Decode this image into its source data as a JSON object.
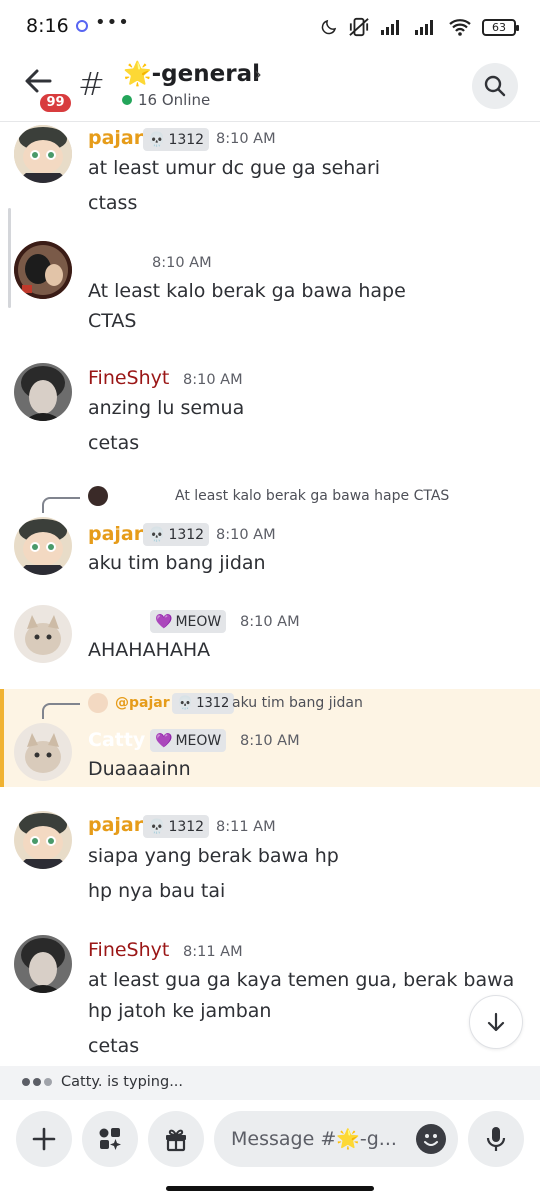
{
  "status_bar": {
    "time": "8:16",
    "battery": "63"
  },
  "header": {
    "back_badge": "99",
    "channel_emoji": "🌟",
    "channel_name": "-general",
    "online_text": "16 Online"
  },
  "messages": [
    {
      "username": "pajar",
      "role": "1312",
      "time": "8:10 AM",
      "lines": [
        "at least umur dc gue ga sehari",
        "ctass"
      ]
    },
    {
      "username": "",
      "time": "8:10 AM",
      "lines": [
        "At least kalo berak ga bawa hape",
        "CTAS"
      ]
    },
    {
      "username": "FineShyt",
      "time": "8:10 AM",
      "lines": [
        "anzing lu semua",
        "cetas"
      ]
    },
    {
      "reply_text": "At least kalo berak ga bawa hape CTAS",
      "username": "pajar",
      "role": "1312",
      "time": "8:10 AM",
      "lines": [
        "aku tim bang jidan"
      ]
    },
    {
      "username": "",
      "role": "MEOW",
      "time": "8:10 AM",
      "lines": [
        "AHAHAHAHA"
      ]
    },
    {
      "reply_mention": "@pajar",
      "reply_role": "1312",
      "reply_text": "aku tim bang jidan",
      "username": "Catty",
      "role": "MEOW",
      "time": "8:10 AM",
      "lines": [
        "Duaaaainn"
      ]
    },
    {
      "username": "pajar",
      "role": "1312",
      "time": "8:11 AM",
      "lines": [
        "siapa yang berak bawa hp",
        "hp nya bau tai"
      ]
    },
    {
      "username": "FineShyt",
      "time": "8:11 AM",
      "lines": [
        "at least gua ga kaya temen gua, berak bawa",
        "hp jatoh ke jamban",
        "cetas"
      ]
    }
  ],
  "typing": {
    "text": "Catty. is typing..."
  },
  "composer": {
    "placeholder": "Message #🌟-g..."
  }
}
